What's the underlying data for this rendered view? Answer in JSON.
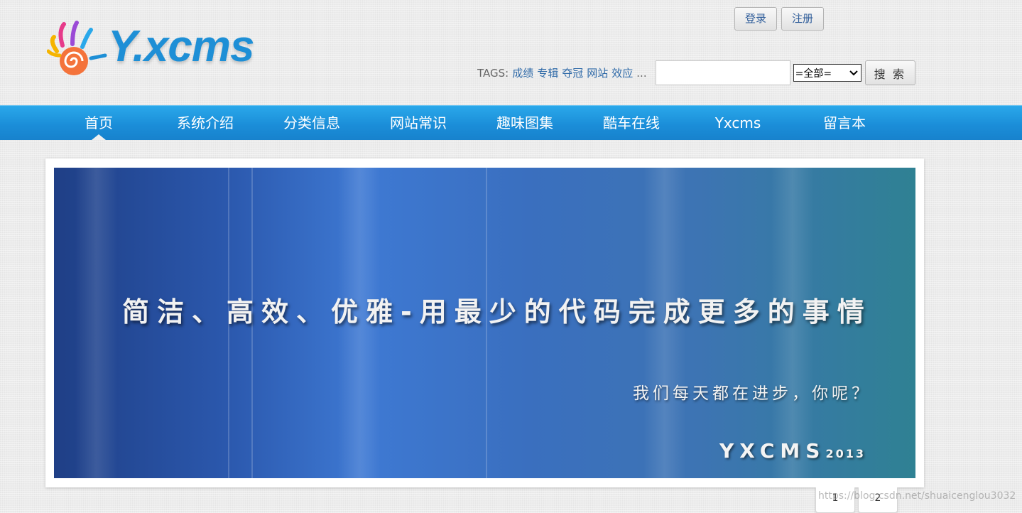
{
  "header": {
    "logo_text": "Y.xcms",
    "login_label": "登录",
    "register_label": "注册"
  },
  "search": {
    "tags_label": "TAGS:",
    "tags": [
      "成绩",
      "专辑",
      "夺冠",
      "网站",
      "效应"
    ],
    "more": "...",
    "input_value": "",
    "scope_selected": "=全部=",
    "button_label": "搜 索"
  },
  "nav": {
    "items": [
      "首页",
      "系统介绍",
      "分类信息",
      "网站常识",
      "趣味图集",
      "酷车在线",
      "Yxcms",
      "留言本"
    ],
    "active_index": 0
  },
  "banner": {
    "headline": "简洁、高效、优雅-用最少的代码完成更多的事情",
    "subline": "我们每天都在进步，你呢？",
    "brand": "YXCMS",
    "year": "2013"
  },
  "pagination": {
    "pages": [
      "1",
      "2"
    ]
  },
  "watermark": "https://blog.csdn.net/shuaicenglou3032",
  "colors": {
    "nav_blue": "#1b8ed9",
    "link_blue": "#2f6aa8",
    "logo_blue": "#1e8fd6"
  }
}
